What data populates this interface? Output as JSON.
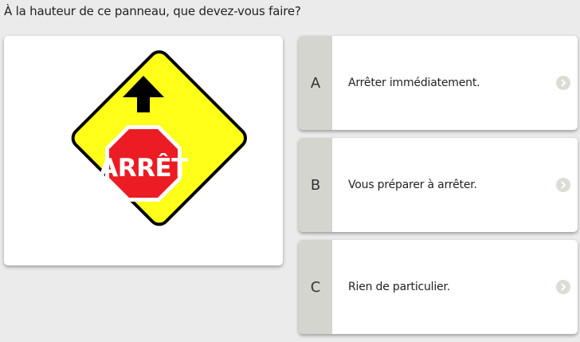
{
  "question": {
    "text": "À la hauteur de ce panneau, que devez-vous faire?"
  },
  "sign": {
    "text": "ARRÊT",
    "icon": "stop-ahead-sign",
    "colors": {
      "diamond": "#ffff1a",
      "octagon": "#ec1c24",
      "outline": "#000000"
    }
  },
  "answers": [
    {
      "letter": "A",
      "text": "Arrêter immédiatement.",
      "icon": "chevron-right-icon"
    },
    {
      "letter": "B",
      "text": "Vous préparer à arrêter.",
      "icon": "chevron-right-icon"
    },
    {
      "letter": "C",
      "text": "Rien de particulier.",
      "icon": "chevron-right-icon"
    }
  ],
  "colors": {
    "background": "#ebebeb",
    "letter_box": "#d4d5cf",
    "arrow_circle": "#dcdcd6"
  }
}
